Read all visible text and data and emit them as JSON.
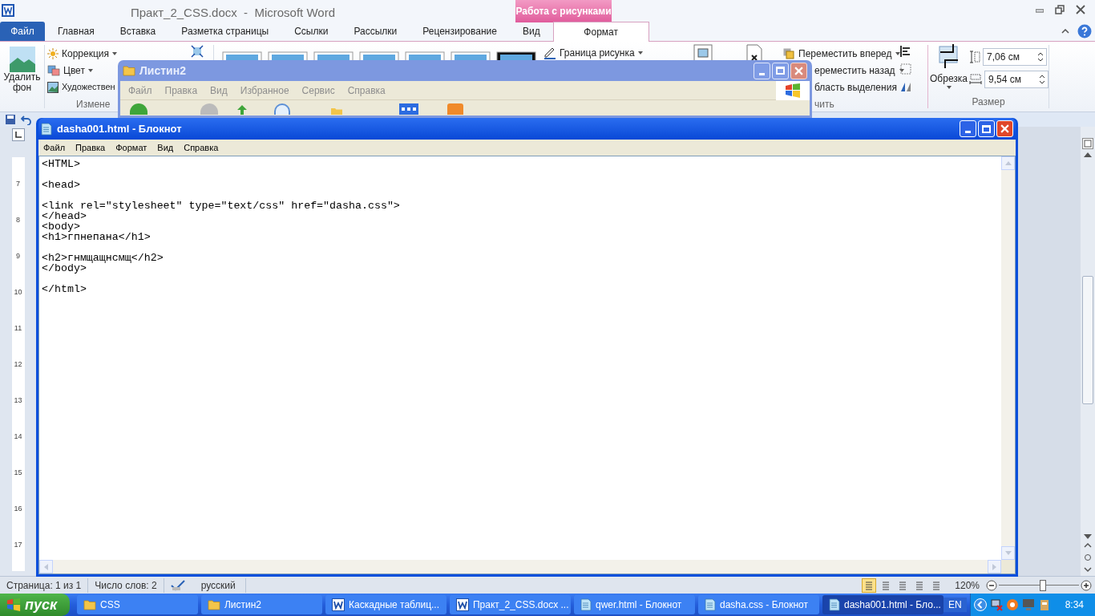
{
  "word": {
    "title": "Практ_2_CSS.docx  -  Microsoft Word",
    "contextual_group": "Работа с рисунками",
    "tabs": [
      {
        "label": "Файл",
        "kind": "file",
        "selected": false
      },
      {
        "label": "Главная",
        "kind": "tab",
        "selected": false
      },
      {
        "label": "Вставка",
        "kind": "tab",
        "selected": false
      },
      {
        "label": "Разметка страницы",
        "kind": "tab",
        "selected": false
      },
      {
        "label": "Ссылки",
        "kind": "tab",
        "selected": false
      },
      {
        "label": "Рассылки",
        "kind": "tab",
        "selected": false
      },
      {
        "label": "Рецензирование",
        "kind": "tab",
        "selected": false
      },
      {
        "label": "Вид",
        "kind": "tab",
        "selected": false
      },
      {
        "label": "Формат",
        "kind": "contextual",
        "selected": true
      }
    ],
    "ribbon": {
      "remove_background": "Удалить фон",
      "adjust_items": [
        "Коррекция",
        "Цвет",
        "Художествен"
      ],
      "adjust_group": "Измене",
      "picture_border": "Граница рисунка",
      "arrange_items": [
        "Переместить вперед",
        "ереместить назад",
        "бласть выделения"
      ],
      "arrange_group": "чить",
      "crop": "Обрезка",
      "height": "7,06 см",
      "width": "9,54 см",
      "size_group": "Размер"
    },
    "ruler_numbers": [
      "7",
      "8",
      "9",
      "10",
      "11",
      "12",
      "13",
      "14",
      "15",
      "16",
      "17"
    ],
    "status_bar": {
      "page": "Страница: 1 из 1",
      "words": "Число слов: 2",
      "language": "русский",
      "views": [
        {
          "selected": true
        },
        {
          "selected": false
        },
        {
          "selected": false
        },
        {
          "selected": false
        },
        {
          "selected": false
        }
      ],
      "zoom": "120%",
      "zoom_slider": {
        "level": 0.55
      }
    }
  },
  "explorer": {
    "title": "Листин2",
    "menu": [
      "Файл",
      "Правка",
      "Вид",
      "Избранное",
      "Сервис",
      "Справка"
    ]
  },
  "notepad": {
    "title": "dasha001.html - Блокнот",
    "menu": [
      "Файл",
      "Правка",
      "Формат",
      "Вид",
      "Справка"
    ],
    "lines": [
      {
        "text": "<HTML>",
        "gap_after": true
      },
      {
        "text": "<head>",
        "gap_after": true
      },
      {
        "text": "<link rel=\"stylesheet\" type=\"text/css\" href=\"dasha.css\">",
        "gap_after": false
      },
      {
        "text": "</head>",
        "gap_after": false
      },
      {
        "text": "<body>",
        "gap_after": false
      },
      {
        "text": "<h1>гпнепана</h1>",
        "gap_after": true
      },
      {
        "text": "<h2>гнмщащнсмщ</h2>",
        "gap_after": false
      },
      {
        "text": "</body>",
        "gap_after": true
      },
      {
        "text": "</html>",
        "gap_after": false
      }
    ]
  },
  "taskbar": {
    "start": "пуск",
    "items": [
      {
        "label": "CSS",
        "kind": "folder",
        "selected": false
      },
      {
        "label": "Листин2",
        "kind": "folder",
        "selected": false
      },
      {
        "label": "Каскадные таблиц...",
        "kind": "word",
        "selected": false
      },
      {
        "label": "Практ_2_CSS.docx ...",
        "kind": "word",
        "selected": false
      },
      {
        "label": "qwer.html - Блокнот",
        "kind": "notepad",
        "selected": false
      },
      {
        "label": "dasha.css - Блокнот",
        "kind": "notepad",
        "selected": false
      },
      {
        "label": "dasha001.html - Бло...",
        "kind": "notepad",
        "selected": true
      }
    ],
    "language": "EN",
    "clock": "8:34"
  }
}
